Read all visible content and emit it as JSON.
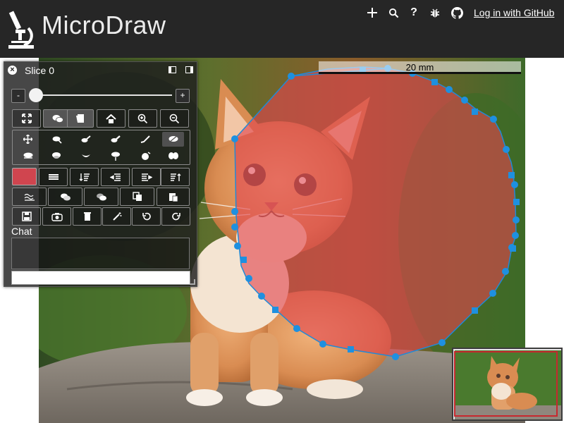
{
  "header": {
    "title": "MicroDraw",
    "login_label": "Log in with GitHub",
    "icons": [
      "plus-icon",
      "search-icon",
      "help-icon",
      "bug-icon",
      "github-icon"
    ]
  },
  "scalebar": {
    "label": "20 mm"
  },
  "panel": {
    "title": "Slice 0",
    "zoom_minus_label": "-",
    "zoom_plus_label": "+",
    "zoom_level": 0.0,
    "chat_label": "Chat",
    "chat_input_value": "",
    "region_color": "#d0454f"
  },
  "colors": {
    "header_bg": "#262626",
    "region_fill": "#e0454f",
    "region_stroke": "#1f8ad8",
    "handle": "#1e90e0",
    "navigator_border": "#c7282f"
  }
}
